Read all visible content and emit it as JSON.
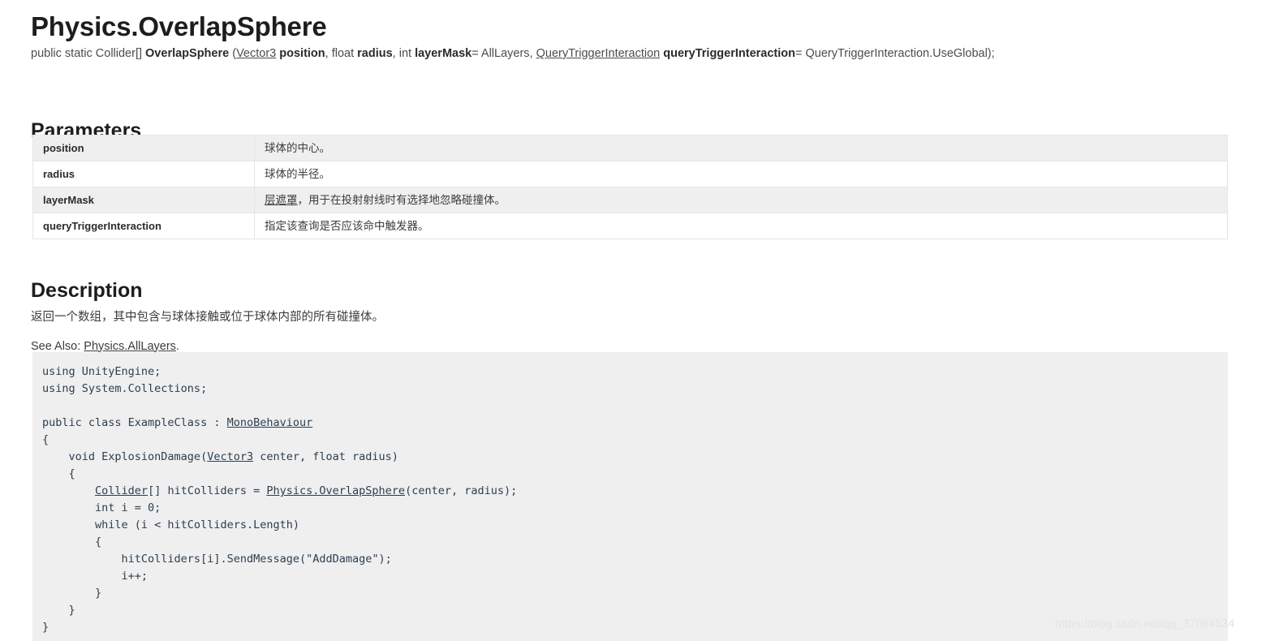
{
  "page": {
    "title": "Physics.OverlapSphere",
    "watermark": "https://blog.csdn.net/qq_37084534"
  },
  "signature": {
    "prefix": "public static Collider[] ",
    "method": "OverlapSphere",
    "open_paren": " (",
    "type1": "Vector3",
    "param1": " position",
    "sep1": ", float ",
    "param2": "radius",
    "sep2": ", int ",
    "param3": "layerMask",
    "default1": "= AllLayers, ",
    "type2": "QueryTriggerInteraction",
    "param4": " queryTriggerInteraction",
    "default2": "= QueryTriggerInteraction.UseGlobal);"
  },
  "parameters": {
    "heading": "Parameters",
    "rows": [
      {
        "name": "position",
        "desc_link": "",
        "desc": "球体的中心。"
      },
      {
        "name": "radius",
        "desc_link": "",
        "desc": "球体的半径。"
      },
      {
        "name": "layerMask",
        "desc_link": "层遮罩",
        "desc": "，用于在投射射线时有选择地忽略碰撞体。"
      },
      {
        "name": "queryTriggerInteraction",
        "desc_link": "",
        "desc": "指定该查询是否应该命中触发器。"
      }
    ]
  },
  "description": {
    "heading": "Description",
    "body": "返回一个数组，其中包含与球体接触或位于球体内部的所有碰撞体。",
    "see_also_label": "See Also: ",
    "see_also_link": "Physics.AllLayers",
    "see_also_suffix": "."
  },
  "code": {
    "line_01": "using UnityEngine;",
    "line_02": "using System.Collections;",
    "line_03": "",
    "line_04_a": "public class ExampleClass : ",
    "line_04_link": "MonoBehaviour",
    "line_05": "{",
    "line_06_a": "    void ExplosionDamage(",
    "line_06_link": "Vector3",
    "line_06_b": " center, float radius)",
    "line_07": "    {",
    "line_08_link1": "Collider",
    "line_08_a": "[] hitColliders = ",
    "line_08_link2": "Physics.OverlapSphere",
    "line_08_b": "(center, radius);",
    "line_08_indent": "        ",
    "line_09": "        int i = 0;",
    "line_10": "        while (i < hitColliders.Length)",
    "line_11": "        {",
    "line_12": "            hitColliders[i].SendMessage(\"AddDamage\");",
    "line_13": "            i++;",
    "line_14": "        }",
    "line_15": "    }",
    "line_16": "}"
  },
  "colors": {
    "code_bg": "#efefef",
    "table_row_alt": "#efefef",
    "text": "#3c3c3c",
    "heading": "#1d1d1d",
    "border": "#e5e5e5"
  }
}
